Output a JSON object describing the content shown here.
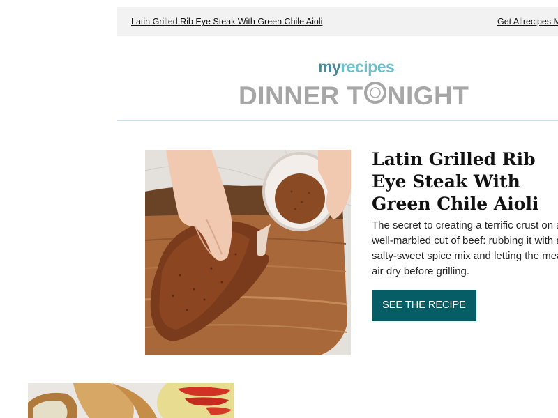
{
  "header": {
    "left_link": "Latin Grilled Rib Eye Steak With Green Chile Aioli",
    "right_link": "Get Allrecipes M"
  },
  "logo": {
    "my": "my",
    "recipes": "recipes",
    "dinner": "DINNER T",
    "tonight_rest": "NIGHT"
  },
  "feature": {
    "title": "Latin Grilled Rib Eye Steak With Green Chile Aioli",
    "description": "The secret to creating a terrific crust on a well-marbled cut of beef: rubbing it with a salty-sweet spice mix and letting the meat air dry before grilling.",
    "button_label": "SEE THE RECIPE",
    "image_icon": "steak-photo",
    "button_color": "#075d66"
  },
  "next_item": {
    "image_icon": "sandwich-photo"
  },
  "colors": {
    "accent": "#075d66",
    "logo_dark": "#4a8a97",
    "logo_light": "#6cc0c8",
    "logo_gray": "#a6a6a6",
    "divider": "#c7dde3"
  }
}
